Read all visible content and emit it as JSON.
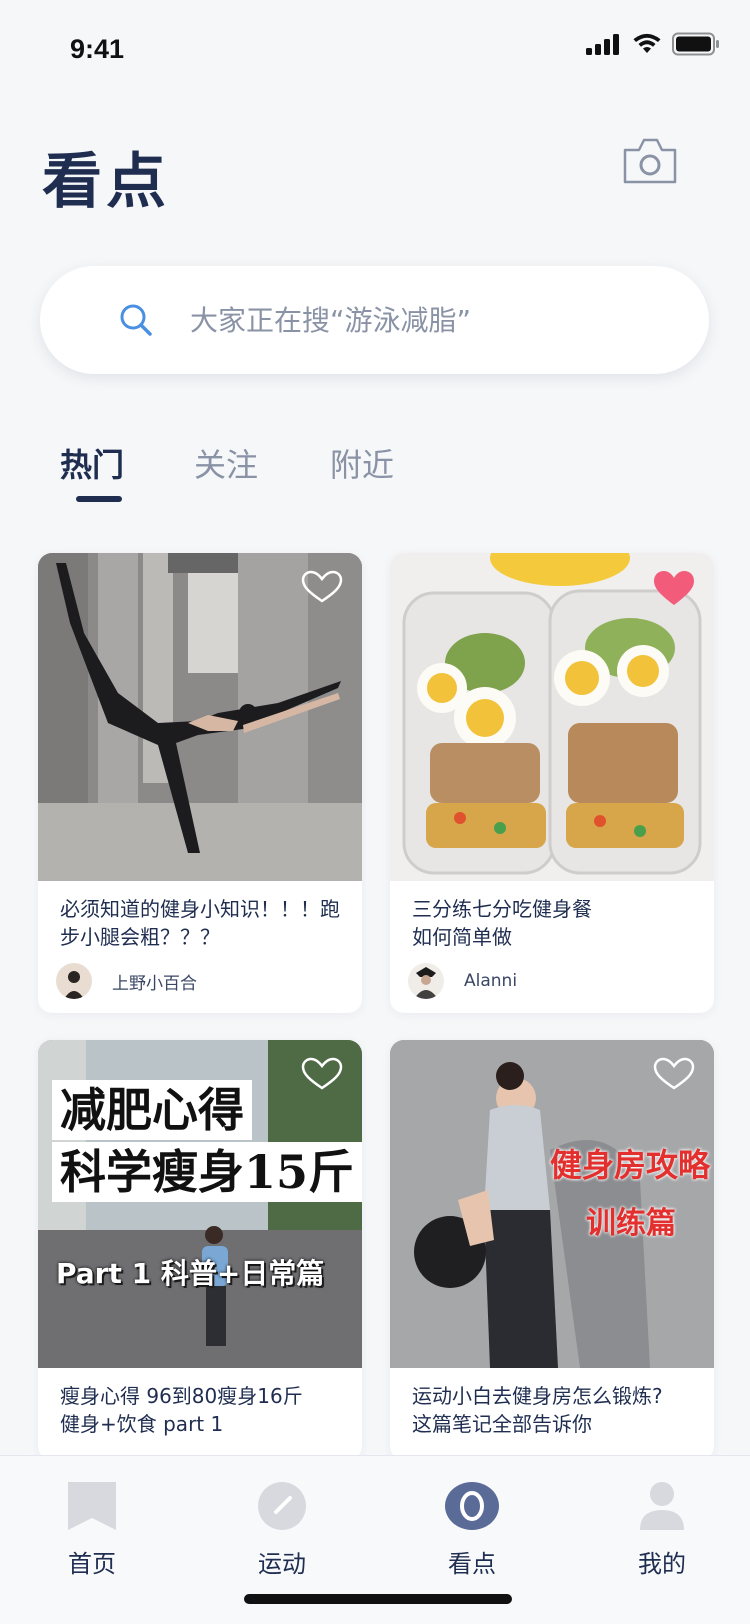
{
  "status_bar": {
    "time": "9:41"
  },
  "header": {
    "title": "看点"
  },
  "search": {
    "placeholder": "大家正在搜“游泳减脂”"
  },
  "tabs": [
    {
      "label": "热门",
      "active": true
    },
    {
      "label": "关注",
      "active": false
    },
    {
      "label": "附近",
      "active": false
    }
  ],
  "cards": [
    {
      "title": "必须知道的健身小知识！！！跑\n步小腿会粗？？？",
      "author": "上野小百合",
      "liked": false
    },
    {
      "title": "三分练七分吃健身餐\n如何简单做",
      "author": "Alanni",
      "liked": true
    },
    {
      "title": "瘦身心得 96到80瘦身16斤\n健身+饮食 part 1",
      "overlay_line1": "减肥心得",
      "overlay_line2": "科学瘦身15斤",
      "overlay_line3": "Part 1 科普+日常篇",
      "liked": false
    },
    {
      "title": "运动小白去健身房怎么锻炼?\n这篇笔记全部告诉你",
      "overlay_line1": "健身房攻略",
      "overlay_line2": "训练篇",
      "liked": false
    }
  ],
  "tabbar": [
    {
      "label": "首页",
      "icon": "bookmark-icon",
      "active": false
    },
    {
      "label": "运动",
      "icon": "speedometer-icon",
      "active": false
    },
    {
      "label": "看点",
      "icon": "discover-icon",
      "active": true
    },
    {
      "label": "我的",
      "icon": "person-icon",
      "active": false
    }
  ],
  "colors": {
    "primary": "#1f2d50",
    "muted": "#8a93a6",
    "accent": "#4a90e2",
    "like": "#f35b7b",
    "inactive_icon": "#d7d9de"
  }
}
